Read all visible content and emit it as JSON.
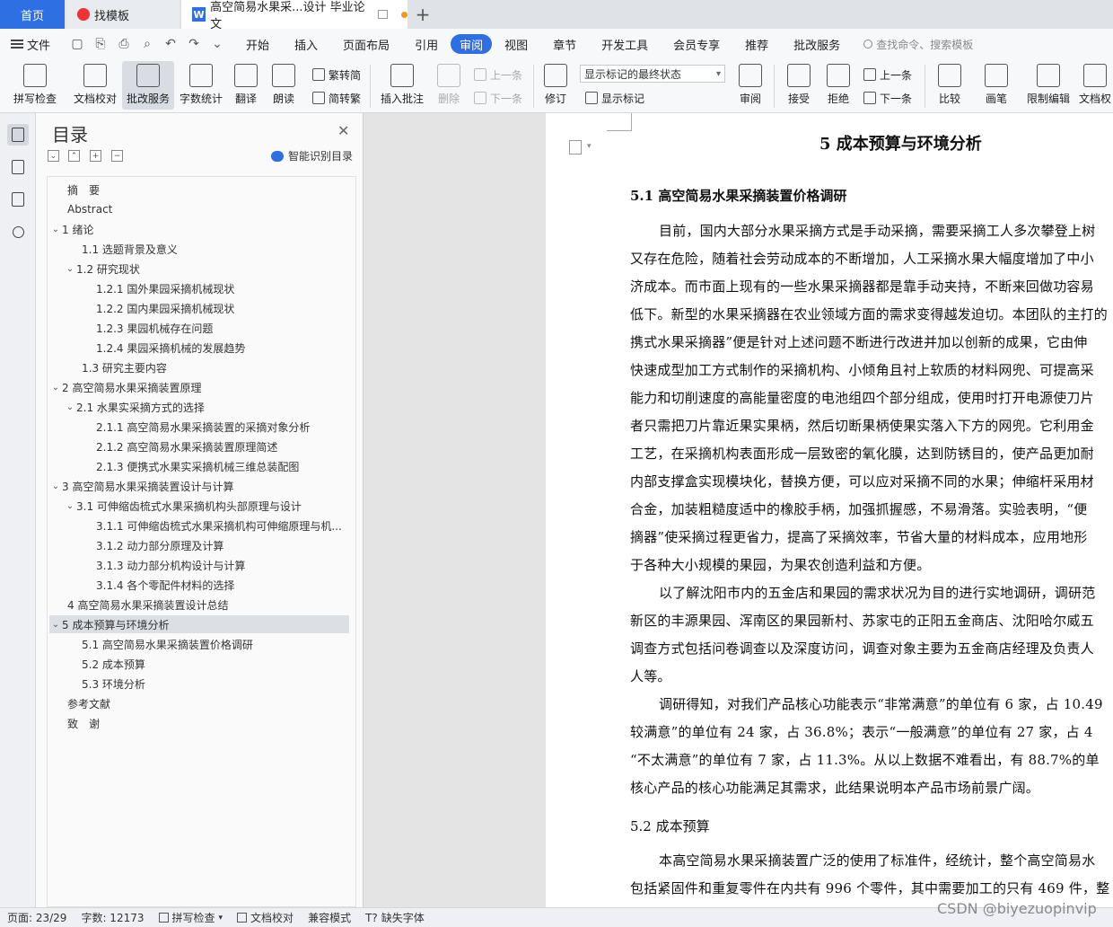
{
  "tabs": {
    "home": "首页",
    "template": "找模板",
    "document": "高空简易水果采...设计 毕业论文",
    "add": "+"
  },
  "menubar": {
    "file": "文件",
    "tabs": [
      "开始",
      "插入",
      "页面布局",
      "引用",
      "审阅",
      "视图",
      "章节",
      "开发工具",
      "会员专享",
      "推荐",
      "批改服务"
    ],
    "active_tab": "审阅",
    "search": "查找命令、搜索模板"
  },
  "ribbon": {
    "spell_check": "拼写检查",
    "doc_check": "文档校对",
    "review_service": "批改服务",
    "word_count": "字数统计",
    "translate": "翻译",
    "read_aloud": "朗读",
    "trad_to_simp": "繁转简",
    "simp_to_trad": "简转繁",
    "insert_comment": "插入批注",
    "delete": "删除",
    "prev": "上一条",
    "next": "下一条",
    "track_changes": "修订",
    "markup_mode": "显示标记的最终状态",
    "show_markup": "显示标记",
    "review": "审阅",
    "accept": "接受",
    "reject": "拒绝",
    "prev2": "上一条",
    "next2": "下一条",
    "compare": "比较",
    "ink": "画笔",
    "restrict_edit": "限制编辑",
    "doc_rights": "文档权"
  },
  "toc": {
    "title": "目录",
    "smart": "智能识别目录",
    "items": [
      "摘　要",
      "Abstract",
      "1  绪论",
      "1.1  选题背景及意义",
      "1.2 研究现状",
      "1.2.1 国外果园采摘机械现状",
      "1.2.2 国内果园采摘机械现状",
      "1.2.3 果园机械存在问题",
      "1.2.4 果园采摘机械的发展趋势",
      "1.3 研究主要内容",
      "2  高空简易水果采摘装置原理",
      "2.1    水果实采摘方式的选择",
      "2.1.1 高空简易水果采摘装置的采摘对象分析",
      "2.1.2 高空简易水果采摘装置原理简述",
      "2.1.3 便携式水果实采摘机械三维总装配图",
      "3  高空简易水果采摘装置设计与计算",
      "3.1 可伸缩齿梳式水果采摘机构头部原理与设计",
      "3.1.1 可伸缩齿梳式水果采摘机构可伸缩原理与机...",
      "3.1.2 动力部分原理及计算",
      "3.1.3 动力部分机构设计与计算",
      "3.1.4 各个零配件材料的选择",
      "4  高空简易水果采摘装置设计总结",
      "5  成本预算与环境分析",
      "5.1  高空简易水果采摘装置价格调研",
      "5.2  成本预算",
      "5.3  环境分析",
      "参考文献",
      "致　谢"
    ]
  },
  "document": {
    "chapter_title": "5  成本预算与环境分析",
    "section1": "5.1  高空简易水果采摘装置价格调研",
    "lines": [
      "目前，国内大部分水果采摘方式是手动采摘，需要采摘工人多次攀登上树",
      "又存在危险，随着社会劳动成本的不断增加，人工采摘水果大幅度增加了中小",
      "济成本。而市面上现有的一些水果采摘器都是靠手动夹持，不断来回做功容易",
      "低下。新型的水果采摘器在农业领域方面的需求变得越发迫切。本团队的主打的",
      "携式水果采摘器”便是针对上述问题不断进行改进并加以创新的成果，它由伸",
      "快速成型加工方式制作的采摘机构、小倾角且衬上软质的材料网兜、可提高采",
      "能力和切削速度的高能量密度的电池组四个部分组成，使用时打开电源使刀片",
      "者只需把刀片靠近果实果柄，然后切断果柄使果实落入下方的网兜。它利用金",
      "工艺，在采摘机构表面形成一层致密的氧化膜，达到防锈目的，使产品更加耐",
      "内部支撑盒实现模块化，替换方便，可以应对采摘不同的水果；伸缩杆采用材",
      "合金，加装粗糙度适中的橡胶手柄，加强抓握感，不易滑落。实验表明，“便",
      "摘器”使采摘过程更省力，提高了采摘效率，节省大量的材料成本，应用地形",
      "于各种大小规模的果园，为果农创造利益和方便。",
      "以了解沈阳市内的五金店和果园的需求状况为目的进行实地调研，调研范",
      "新区的丰源果园、浑南区的果园新村、苏家屯的正阳五金商店、沈阳哈尔威五",
      "调查方式包括问卷调查以及深度访问，调查对象主要为五金商店经理及负责人",
      "人等。",
      "调研得知，对我们产品核心功能表示“非常满意”的单位有 6 家，占 10.49",
      "较满意”的单位有 24 家，占 36.8%；表示“一般满意”的单位有 27 家，占 4",
      "“不太满意”的单位有 7 家，占 11.3%。从以上数据不难看出，有 88.7%的单",
      "核心产品的核心功能满足其需求，此结果说明本产品市场前景广阔。"
    ],
    "section2": "5.2  成本预算",
    "lines2": [
      "本高空简易水果采摘装置广泛的使用了标准件，经统计，整个高空简易水",
      "包括紧固件和重复零件在内共有 996 个零件，其中需要加工的只有 469 件，整"
    ]
  },
  "status": {
    "page": "页面: 23/29",
    "words": "字数: 12173",
    "spell": "拼写检查",
    "doc_check": "文档校对",
    "compat": "兼容模式",
    "missing_font": "缺失字体"
  },
  "watermark": "CSDN @biyezuopinvip"
}
